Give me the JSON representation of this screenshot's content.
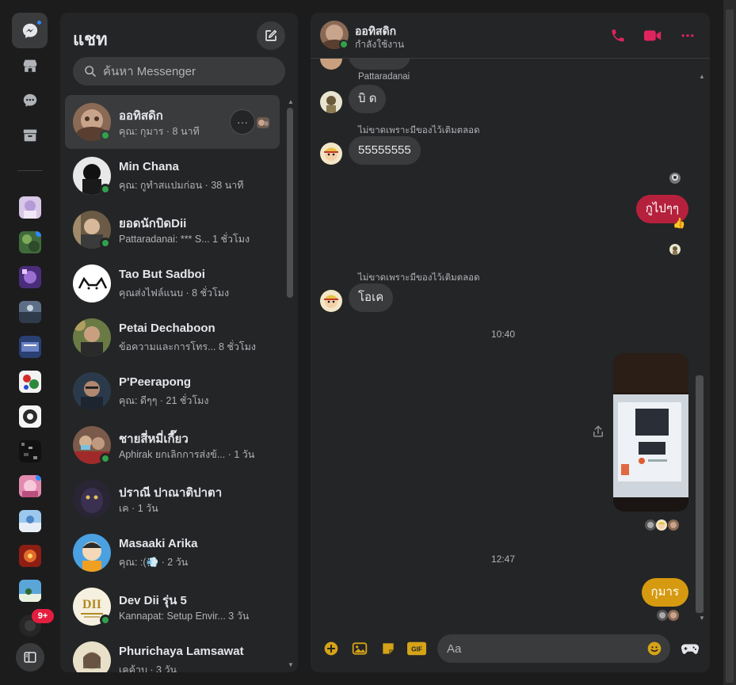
{
  "colors": {
    "accent_messenger": "#2e89ff",
    "call_icons": "#e0245e",
    "composer_icons": "#d6a318",
    "online": "#31a24c",
    "outgoing_red": "#b5213c",
    "outgoing_gold": "#d69a10",
    "badge_red": "#e41e3f"
  },
  "rail": {
    "icons": [
      "chats-icon",
      "marketplace-icon",
      "requests-icon",
      "archive-icon"
    ],
    "badge": "9+"
  },
  "list": {
    "title": "แชท",
    "search_placeholder": "ค้นหา Messenger",
    "conversations": [
      {
        "name": "ออทิสดิก",
        "preview": "คุณ: กุมาร · 8 นาที",
        "online": true,
        "selected": true
      },
      {
        "name": "Min Chana",
        "preview": "คุณ: กูทำสแปมก่อน · 38 นาที",
        "online": true
      },
      {
        "name": "ยอดนักบิดDii",
        "preview": "Pattaradanai: *** S...  1 ชั่วโมง",
        "online": true
      },
      {
        "name": "Tao But Sadboi",
        "preview": "คุณส่งไฟล์แนบ · 8 ชั่วโมง",
        "online": false
      },
      {
        "name": "Petai Dechaboon",
        "preview": "ข้อความและการโทร...  8 ชั่วโมง",
        "online": false
      },
      {
        "name": "P'Peerapong",
        "preview": "คุณ: ดีๆๆ · 21 ชั่วโมง",
        "online": false
      },
      {
        "name": "ชายสี่หมี่เกี๊ยว",
        "preview": "Aphirak ยกเลิกการส่งข้... · 1 วัน",
        "online": true
      },
      {
        "name": "ปราณี ปาณาติปาตา",
        "preview": "เค · 1 วัน",
        "online": false
      },
      {
        "name": "Masaaki Arika",
        "preview": "คุณ: :(💨 · 2 วัน",
        "online": false
      },
      {
        "name": "Dev Dii รุ่น 5",
        "preview": "Kannapat: Setup Envir...  3 วัน",
        "online": true
      },
      {
        "name": "Phurichaya Lamsawat",
        "preview": "เคค้าบ · 3 วัน",
        "online": false
      }
    ]
  },
  "chat": {
    "name": "ออทิสดิก",
    "status": "กำลังใช้งาน",
    "messages": {
      "sender1": "Pattaradanai",
      "msg1": "บิ ด",
      "sender2": "ไม่ขาดเพราะมีของไว้เติมตลอด",
      "msg2": "55555555",
      "out1": "กูไปๆๆ",
      "out1_reaction": "👍",
      "sender3": "ไม่ขาดเพราะมีของไว้เติมตลอด",
      "msg3": "โอเค",
      "time1": "10:40",
      "time2": "12:47",
      "out2": "กุมาร"
    },
    "composer_placeholder": "Aa"
  }
}
